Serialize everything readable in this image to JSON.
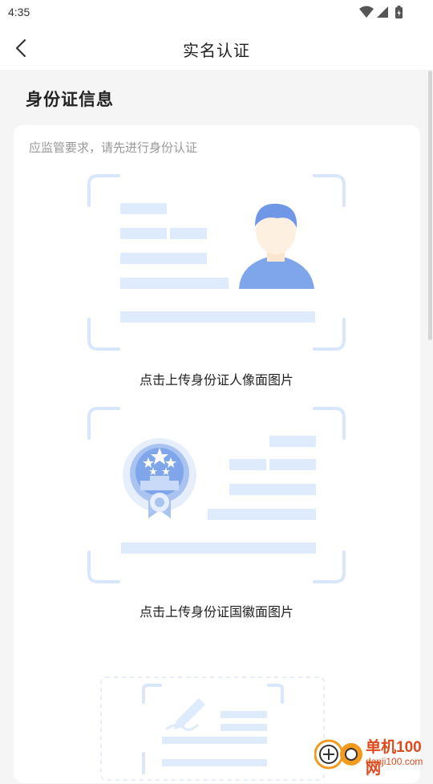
{
  "status_bar": {
    "time": "4:35",
    "icons": [
      "wifi-icon",
      "signal-icon",
      "battery-icon"
    ]
  },
  "nav": {
    "title": "实名认证",
    "back_icon": "chevron-left-icon"
  },
  "section": {
    "title": "身份证信息"
  },
  "card": {
    "hint": "应监管要求，请先进行身份认证"
  },
  "uploads": [
    {
      "label": "点击上传身份证人像面图片",
      "icon": "id-card-portrait-illustration"
    },
    {
      "label": "点击上传身份证国徽面图片",
      "icon": "id-card-emblem-illustration"
    },
    {
      "icon": "signature-illustration"
    }
  ],
  "watermark": {
    "top": "单机100网",
    "bottom": "danji100.com"
  },
  "colors": {
    "frame": "#d8e7fb",
    "bar": "#deebfc",
    "accent": "#6f97e6",
    "watermark": "#e0491b"
  }
}
